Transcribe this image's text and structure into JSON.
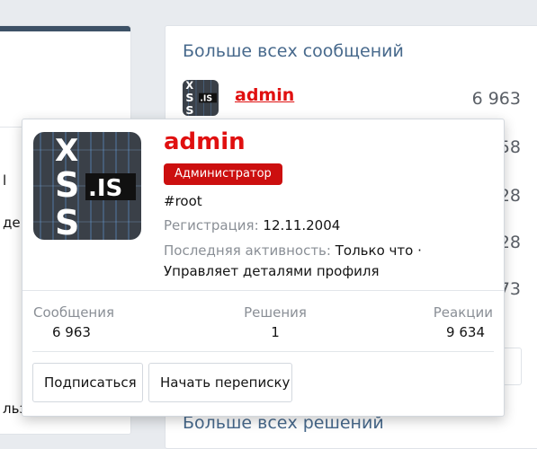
{
  "left_fragments": [
    "l",
    "де",
    "льз"
  ],
  "widget": {
    "title": "Больше всех сообщений",
    "top_user": {
      "name": "admin",
      "count": "6 963"
    },
    "ghost_counts": [
      "58",
      "28",
      "28",
      "73"
    ],
    "next_title": "Больше всех решений"
  },
  "popup": {
    "name": "admin",
    "badge": "Администратор",
    "user_title": "#root",
    "registration_label": "Регистрация:",
    "registration_value": "12.11.2004",
    "activity_label": "Последняя активность:",
    "activity_value": "Только что · Управляет деталями профиля",
    "stats": [
      {
        "label": "Сообщения",
        "value": "6 963"
      },
      {
        "label": "Решения",
        "value": "1"
      },
      {
        "label": "Реакции",
        "value": "9 634"
      }
    ],
    "follow_label": "Подписаться",
    "conversation_label": "Начать переписку"
  },
  "avatar_logo": {
    "text": ".IS",
    "letters": [
      "X",
      "S",
      "S"
    ]
  },
  "colors": {
    "accent": "#e01010",
    "badge": "#cc0f0f",
    "link_blue": "#47698c"
  }
}
